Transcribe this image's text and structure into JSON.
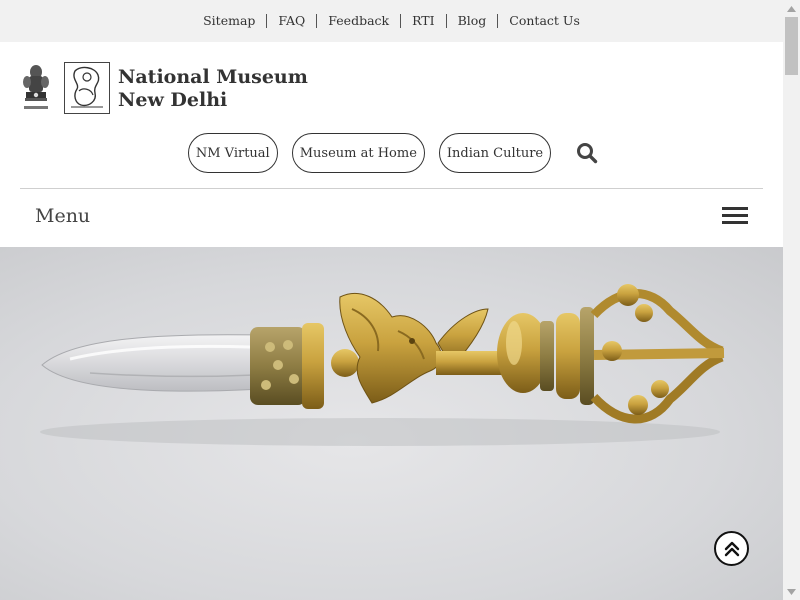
{
  "topbar": {
    "links": [
      "Sitemap",
      "FAQ",
      "Feedback",
      "RTI",
      "Blog",
      "Contact Us"
    ]
  },
  "header": {
    "title_line1": "National Museum",
    "title_line2": "New Delhi",
    "emblem_icon": "india-state-emblem-icon",
    "logo_icon": "national-museum-logo-icon"
  },
  "nav": {
    "pills": [
      "NM Virtual",
      "Museum at Home",
      "Indian Culture"
    ],
    "search_icon": "search-icon"
  },
  "menu": {
    "label": "Menu",
    "icon": "hamburger-menu-icon"
  },
  "hero": {
    "image": "phurba ritual dagger with crystal blade and gilt handle"
  },
  "colors": {
    "topbar_bg": "#f1f1f1",
    "text": "#333333",
    "gold": "#b08a2e"
  }
}
